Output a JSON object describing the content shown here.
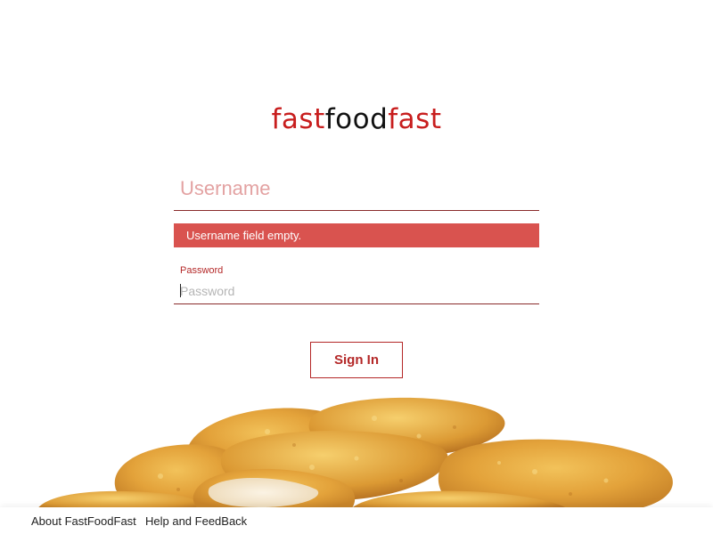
{
  "logo": {
    "part1": "fast",
    "part2": "food",
    "part3": "fast",
    "accent_color": "#c81e1e",
    "dark_color": "#111111"
  },
  "login": {
    "username_placeholder": "Username",
    "username_value": "",
    "error_message": "Username field empty.",
    "password_label": "Password",
    "password_placeholder": "Password",
    "password_value": "",
    "signin_label": "Sign In"
  },
  "colors": {
    "error_background": "#d9534f",
    "brand_red": "#b42828"
  },
  "illustration": {
    "icon": "chicken-nuggets-image"
  },
  "footer": {
    "about_label": "About FastFoodFast",
    "help_label": "Help and FeedBack"
  }
}
